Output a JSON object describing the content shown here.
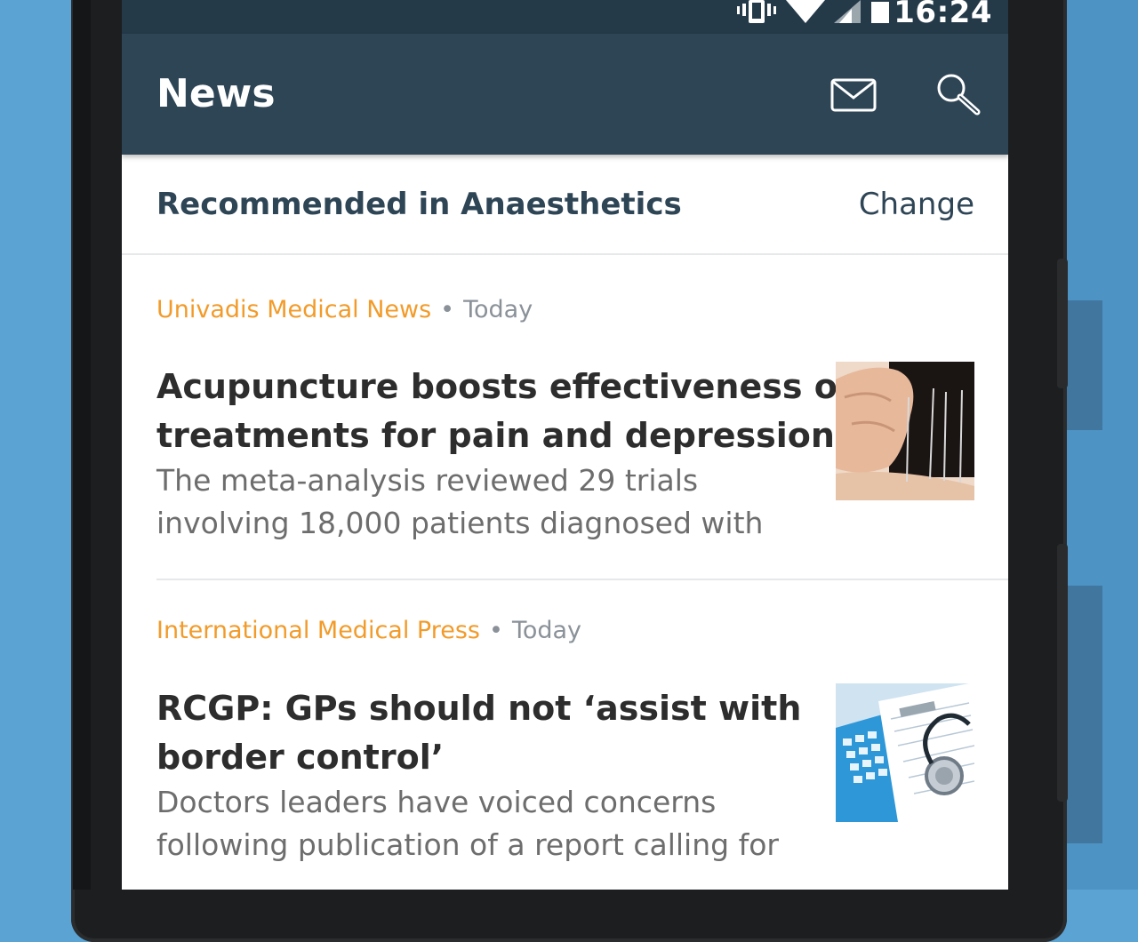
{
  "status_bar": {
    "time": "16:24",
    "icons": [
      "vibrate-icon",
      "wifi-icon",
      "cell-signal-icon",
      "battery-icon"
    ]
  },
  "app_bar": {
    "title": "News",
    "icons": [
      "mail-icon",
      "search-icon"
    ],
    "color": "#2e4556"
  },
  "section": {
    "title": "Recommended in Anaesthetics",
    "change_label": "Change"
  },
  "articles": [
    {
      "source": "Univadis Medical News",
      "separator": "•",
      "age": "Today",
      "headline_line1": "Acupuncture boosts effectiveness of",
      "headline_line2": "treatments for pain and depression",
      "summary_line1": "The meta-analysis reviewed 29 trials",
      "summary_line2": "involving 18,000 patients diagnosed with",
      "thumbnail": "acupuncture-thumbnail"
    },
    {
      "source": "International Medical Press",
      "separator": "•",
      "age": "Today",
      "headline_line1": "RCGP: GPs should not ‘assist with",
      "headline_line2": "border control’",
      "summary_line1": "Doctors leaders have voiced concerns",
      "summary_line2": "following publication of a report calling for",
      "thumbnail": "medical-billing-thumbnail"
    }
  ],
  "colors": {
    "source_accent": "#f29b2a",
    "background": "#5aa3d3"
  }
}
